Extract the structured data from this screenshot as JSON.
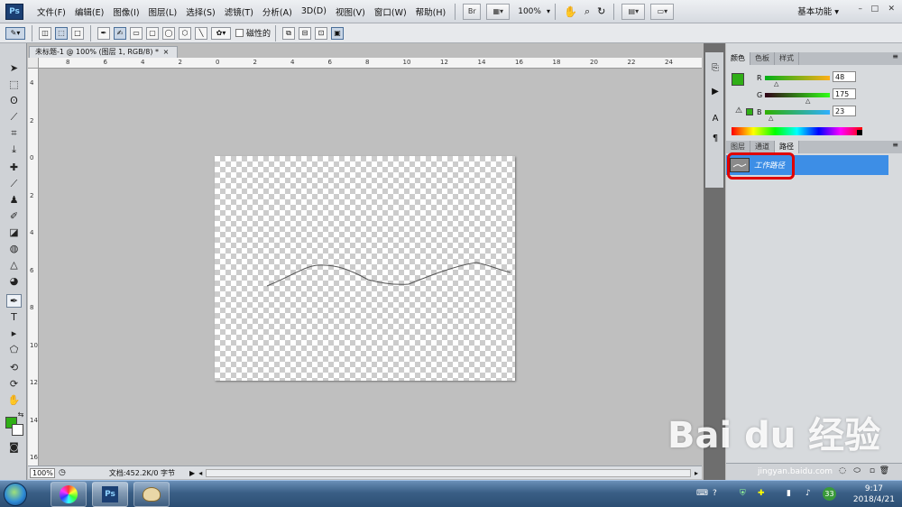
{
  "app": {
    "logo": "Ps"
  },
  "menu": [
    "文件(F)",
    "编辑(E)",
    "图像(I)",
    "图层(L)",
    "选择(S)",
    "滤镜(T)",
    "分析(A)",
    "3D(D)",
    "视图(V)",
    "窗口(W)",
    "帮助(H)"
  ],
  "appbar": {
    "bridge_label": "Br",
    "zoom": "100%",
    "workspace": "基本功能",
    "minimize": "–",
    "restore": "□",
    "close": "✕"
  },
  "options": {
    "magnetic_label": "磁性的"
  },
  "document": {
    "tab_title": "未标题-1 @ 100% (图层 1, RGB/8) *",
    "tab_close": "×",
    "zoom": "100%",
    "doc_info": "文档:452.2K/0 字节"
  },
  "ruler": {
    "h_labels": [
      "8",
      "6",
      "4",
      "2",
      "0",
      "2",
      "4",
      "6",
      "8",
      "10",
      "12",
      "14",
      "16",
      "18",
      "20",
      "22",
      "24"
    ],
    "v_labels": [
      "4",
      "2",
      "0",
      "2",
      "4",
      "6",
      "8",
      "10",
      "12",
      "14",
      "16"
    ]
  },
  "color_panel": {
    "tabs": [
      "颜色",
      "色板",
      "样式"
    ],
    "r_label": "R",
    "g_label": "G",
    "b_label": "B",
    "r": "48",
    "g": "175",
    "b": "23",
    "fg_color": "#30af17",
    "bg_color": "#ffffff"
  },
  "layers_panel": {
    "tabs": [
      "图层",
      "通道",
      "路径"
    ],
    "active_tab": "路径",
    "path_name": "工作路径"
  },
  "taskbar": {
    "time": "9:17",
    "date": "2018/4/21",
    "tray_badge": "33"
  },
  "watermark": {
    "text": "Bai du 经验",
    "url": "jingyan.baidu.com"
  },
  "icons": [
    "move-icon",
    "marquee-icon",
    "lasso-icon",
    "quick-select-icon",
    "crop-icon",
    "eyedropper-icon",
    "healing-icon",
    "brush-icon",
    "stamp-icon",
    "history-brush-icon",
    "eraser-icon",
    "gradient-icon",
    "blur-icon",
    "dodge-icon",
    "pen-icon",
    "type-icon",
    "path-select-icon",
    "shape-icon",
    "3d-rotate-icon",
    "3d-orbit-icon",
    "hand-icon",
    "zoom-icon"
  ]
}
